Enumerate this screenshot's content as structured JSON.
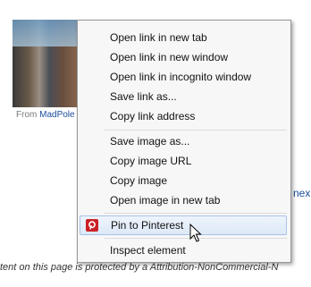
{
  "background": {
    "caption_prefix": "From",
    "caption_link": "MadPole",
    "next_link": "nex",
    "footer_text": "tent on this page is protected by a Attribution-NonCommercial-N"
  },
  "menu": {
    "items": [
      "Open link in new tab",
      "Open link in new window",
      "Open link in incognito window",
      "Save link as...",
      "Copy link address",
      "Save image as...",
      "Copy image URL",
      "Copy image",
      "Open image in new tab",
      "Pin to Pinterest",
      "Inspect element"
    ],
    "highlighted_item": "Pin to Pinterest",
    "pinterest_icon": "pinterest-icon"
  },
  "colors": {
    "menu_bg": "#f7f7f7",
    "highlight_bg": "#dde9f8",
    "pinterest_red": "#cb2027",
    "link": "#1a4d9a"
  }
}
